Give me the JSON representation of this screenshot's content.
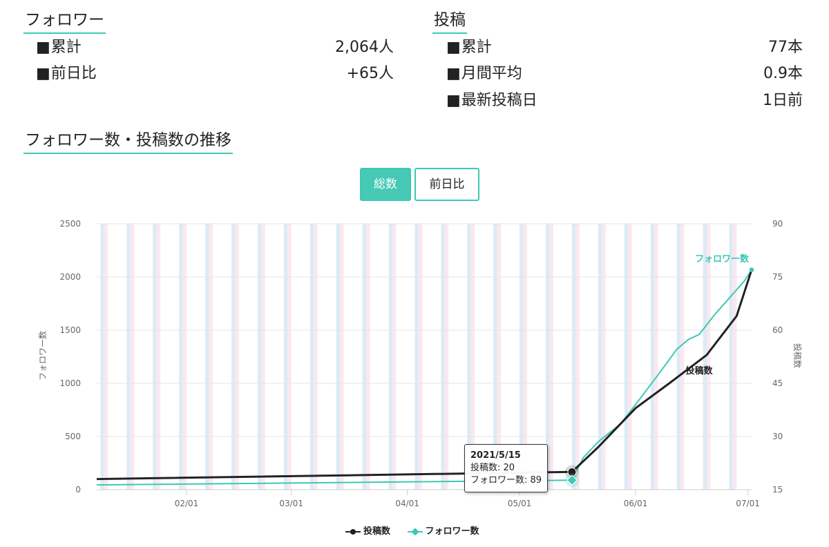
{
  "followers": {
    "heading": "フォロワー",
    "rows": [
      {
        "label": "累計",
        "value": "2,064人"
      },
      {
        "label": "前日比",
        "value": "+65人"
      }
    ]
  },
  "posts": {
    "heading": "投稿",
    "rows": [
      {
        "label": "累計",
        "value": "77本"
      },
      {
        "label": "月間平均",
        "value": "0.9本"
      },
      {
        "label": "最新投稿日",
        "value": "1日前"
      }
    ]
  },
  "trend": {
    "heading": "フォロワー数・投稿数の推移",
    "toggle_total": "総数",
    "toggle_daily": "前日比"
  },
  "tooltip": {
    "date": "2021/5/15",
    "posts_line": "投稿数: 20",
    "followers_line": "フォロワー数: 89"
  },
  "legend": {
    "posts": "投稿数",
    "followers": "フォロワー数"
  },
  "colors": {
    "accent": "#3cc8b4",
    "followers_line": "#3cc8b4",
    "posts_line": "#222222",
    "weekend_blue": "#dcebf6",
    "weekend_pink": "#fbe8ee",
    "grid": "#e6e6e6"
  },
  "chart_data": {
    "type": "line",
    "x_tick_labels": [
      "02/01",
      "03/01",
      "04/01",
      "05/01",
      "06/01",
      "07/01"
    ],
    "x_range": [
      "2021-01-08",
      "2021-07-02"
    ],
    "y_left": {
      "label": "フォロワー数",
      "ticks": [
        0,
        500,
        1000,
        1500,
        2000,
        2500
      ],
      "range": [
        0,
        2500
      ]
    },
    "y_right": {
      "label": "投稿数",
      "ticks": [
        15,
        30,
        45,
        60,
        75,
        90
      ],
      "range": [
        15,
        90
      ]
    },
    "grid": true,
    "legend_position": "bottom",
    "series": [
      {
        "name": "投稿数",
        "axis": "right",
        "x": [
          "2021-01-08",
          "2021-05-15",
          "2021-05-22",
          "2021-06-01",
          "2021-06-10",
          "2021-06-20",
          "2021-06-28",
          "2021-07-02"
        ],
        "values": [
          18,
          20,
          27,
          38,
          45,
          53,
          64,
          77
        ]
      },
      {
        "name": "フォロワー数",
        "axis": "left",
        "x": [
          "2021-01-08",
          "2021-05-15",
          "2021-05-18",
          "2021-05-22",
          "2021-05-28",
          "2021-06-01",
          "2021-06-07",
          "2021-06-12",
          "2021-06-15",
          "2021-06-18",
          "2021-06-22",
          "2021-06-26",
          "2021-06-30",
          "2021-07-02"
        ],
        "values": [
          45,
          89,
          300,
          450,
          620,
          800,
          1080,
          1320,
          1410,
          1460,
          1640,
          1800,
          1960,
          2064
        ]
      }
    ],
    "series_labels": [
      "フォロワー数",
      "投稿数"
    ],
    "highlight": {
      "x": "2021-05-15",
      "posts": 20,
      "followers": 89
    }
  }
}
